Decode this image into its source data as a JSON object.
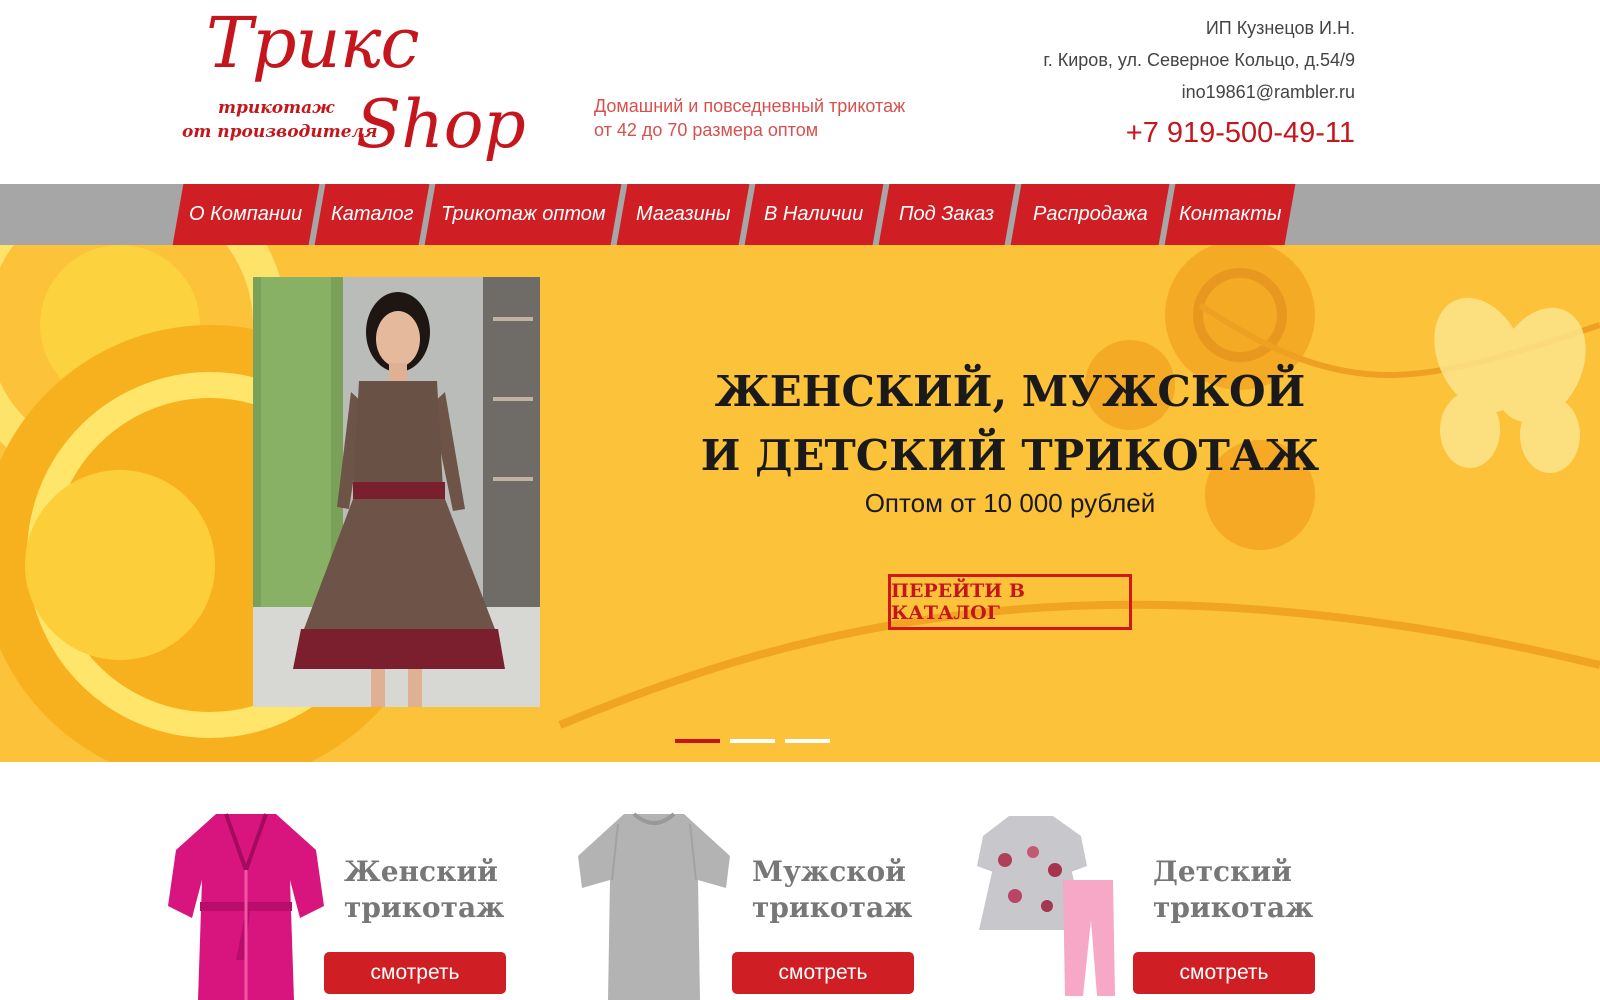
{
  "brand": {
    "logo_word1": "Трикс",
    "logo_word2": "Shop",
    "logo_tag1": "трикотаж",
    "logo_tag2": "от производителя",
    "color": "#c4161c"
  },
  "tagline": {
    "line1": "Домашний и повседневный трикотаж",
    "line2": "от 42 до 70 размера оптом"
  },
  "contacts": {
    "owner": "ИП Кузнецов И.Н.",
    "address": "г. Киров, ул. Северное Кольцо, д.54/9",
    "email": "ino19861@rambler.ru",
    "phone": "+7 919-500-49-11"
  },
  "nav": {
    "items": [
      {
        "label": "О Компании"
      },
      {
        "label": "Каталог"
      },
      {
        "label": "Трикотаж оптом"
      },
      {
        "label": "Магазины"
      },
      {
        "label": "В Наличии"
      },
      {
        "label": "Под Заказ"
      },
      {
        "label": "Распродажа"
      },
      {
        "label": "Контакты"
      }
    ]
  },
  "hero": {
    "title_line1": "ЖЕНСКИЙ, МУЖСКОЙ",
    "title_line2": "И ДЕТСКИЙ ТРИКОТАЖ",
    "subtitle": "Оптом от 10 000 рублей",
    "button_label": "ПЕРЕЙТИ В КАТАЛОГ",
    "slides_total": 3,
    "active_slide": 1
  },
  "categories": [
    {
      "title_line1": "Женский",
      "title_line2": "трикотаж",
      "button": "смотреть",
      "image": "pink-robe-image"
    },
    {
      "title_line1": "Мужской",
      "title_line2": "трикотаж",
      "button": "смотреть",
      "image": "grey-tshirt-image"
    },
    {
      "title_line1": "Детский",
      "title_line2": "трикотаж",
      "button": "смотреть",
      "image": "kids-dress-image"
    }
  ],
  "colors": {
    "accent": "#cf1f25",
    "nav_bg": "#a6a6a6",
    "hero_bg": "#fcc23a"
  }
}
